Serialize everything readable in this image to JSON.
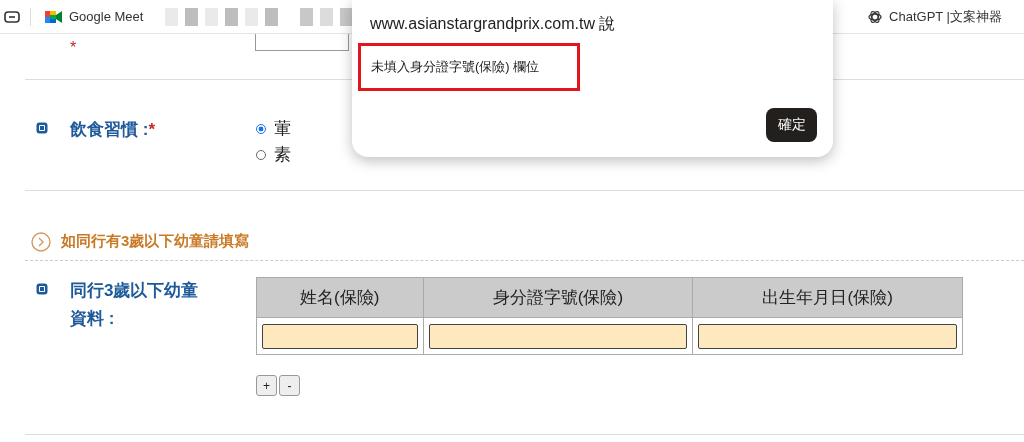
{
  "bookmarks_bar": {
    "items": [
      {
        "kind": "meet",
        "label": "Google Meet"
      },
      {
        "kind": "blurred"
      },
      {
        "kind": "blurred"
      },
      {
        "kind": "chatgpt",
        "label": "ChatGPT |文案神器"
      }
    ]
  },
  "form": {
    "previous_row": {
      "required": true,
      "required_mark": "*"
    },
    "diet": {
      "label": "飲食習慣 :",
      "required": true,
      "required_mark": "*",
      "options": [
        {
          "label": "葷",
          "selected": true
        },
        {
          "label": "素",
          "selected": false
        }
      ]
    },
    "section_heading": "如同行有3歲以下幼童請填寫",
    "children": {
      "label": "同行3歲以下幼童資料 :",
      "columns": [
        "姓名(保險)",
        "身分證字號(保險)",
        "出生年月日(保險)"
      ],
      "rows": [
        {
          "fields": [
            {
              "highlighted": true
            },
            {
              "highlighted": true
            },
            {
              "highlighted": true
            }
          ]
        }
      ],
      "buttons": [
        "+",
        "-"
      ]
    }
  },
  "dialog": {
    "title": "www.asianstargrandprix.com.tw 說",
    "message": "未填入身分證字號(保險) 欄位",
    "message_outlined": true,
    "ok_button": "確定"
  }
}
